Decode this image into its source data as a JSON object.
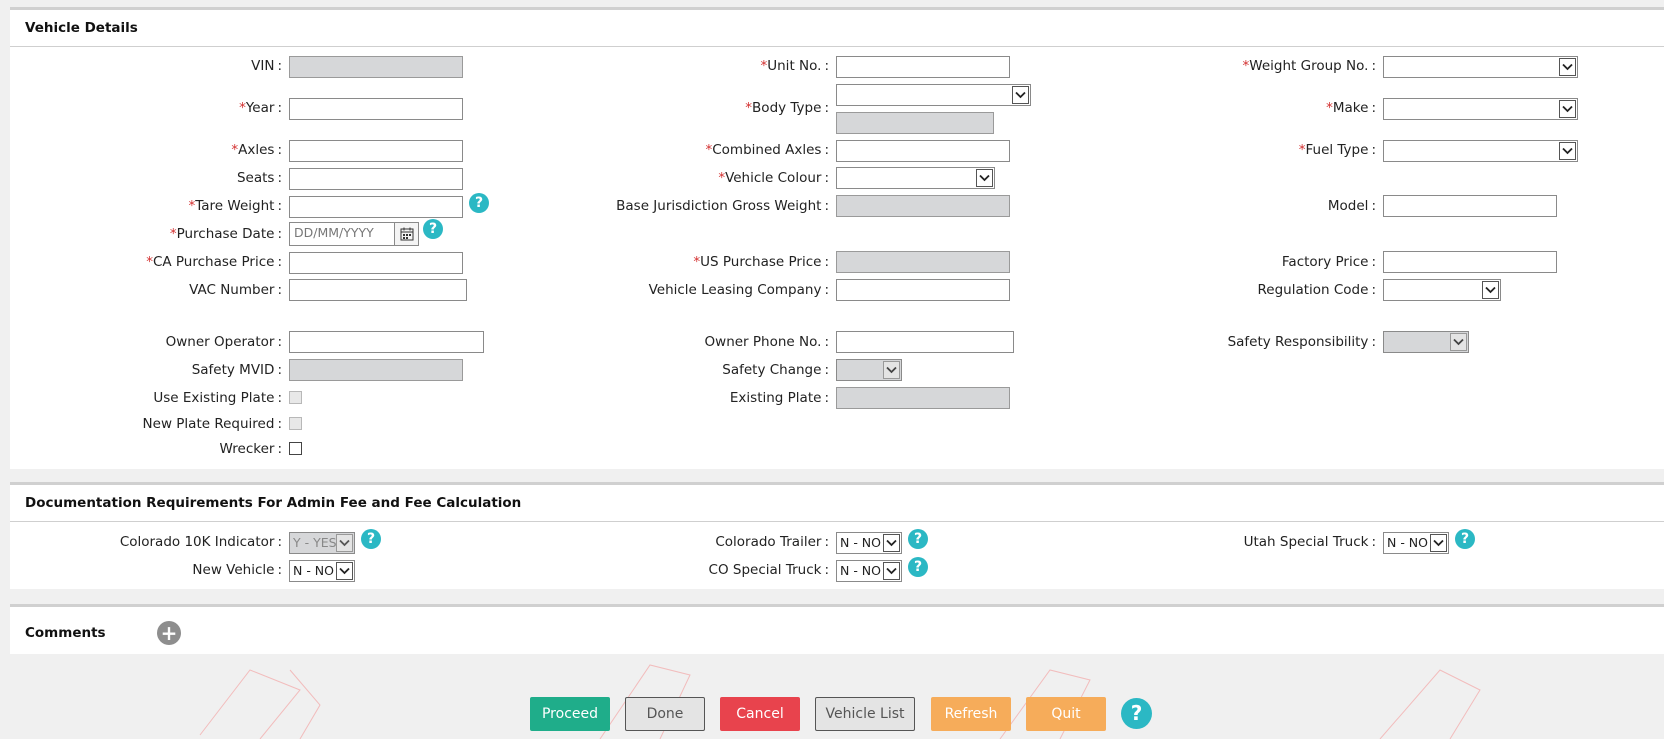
{
  "vehicle_details": {
    "title": "Vehicle Details",
    "fields": {
      "vin": "VIN",
      "unit_no": "Unit No.",
      "weight_group_no": "Weight Group No.",
      "year": "Year",
      "body_type": "Body Type",
      "make": "Make",
      "axles": "Axles",
      "combined_axles": "Combined Axles",
      "fuel_type": "Fuel Type",
      "seats": "Seats",
      "vehicle_colour": "Vehicle Colour",
      "tare_weight": "Tare Weight",
      "base_jurisdiction_gross_weight": "Base Jurisdiction Gross Weight",
      "model": "Model",
      "purchase_date": "Purchase Date",
      "purchase_date_placeholder": "DD/MM/YYYY",
      "ca_purchase_price": "CA Purchase Price",
      "us_purchase_price": "US Purchase Price",
      "factory_price": "Factory Price",
      "vac_number": "VAC Number",
      "vehicle_leasing_company": "Vehicle Leasing Company",
      "regulation_code": "Regulation Code",
      "owner_operator": "Owner Operator",
      "owner_phone_no": "Owner Phone No.",
      "safety_responsibility": "Safety Responsibility",
      "safety_mvid": "Safety MVID",
      "safety_change": "Safety Change",
      "use_existing_plate": "Use Existing Plate",
      "existing_plate": "Existing Plate",
      "new_plate_required": "New Plate Required",
      "wrecker": "Wrecker"
    }
  },
  "documentation": {
    "title": "Documentation Requirements For Admin Fee and Fee Calculation",
    "fields": {
      "colorado_10k_indicator": "Colorado 10K Indicator",
      "colorado_10k_value": "Y - YES",
      "colorado_trailer": "Colorado Trailer",
      "colorado_trailer_value": "N - NO",
      "utah_special_truck": "Utah Special Truck",
      "utah_special_truck_value": "N - NO",
      "new_vehicle": "New Vehicle",
      "new_vehicle_value": "N - NO",
      "co_special_truck": "CO Special Truck",
      "co_special_truck_value": "N - NO"
    }
  },
  "comments": {
    "title": "Comments"
  },
  "actions": {
    "proceed": "Proceed",
    "done": "Done",
    "cancel": "Cancel",
    "vehicle_list": "Vehicle List",
    "refresh": "Refresh",
    "quit": "Quit"
  },
  "symbols": {
    "required": "*",
    "colon": ":",
    "help": "?",
    "plus": "+"
  },
  "colors": {
    "required": "#d32f2f",
    "help": "#2bb8c4",
    "proceed": "#1fad8a",
    "cancel": "#e8434d",
    "refresh": "#f6ac5a",
    "quit": "#f6ac5a"
  }
}
